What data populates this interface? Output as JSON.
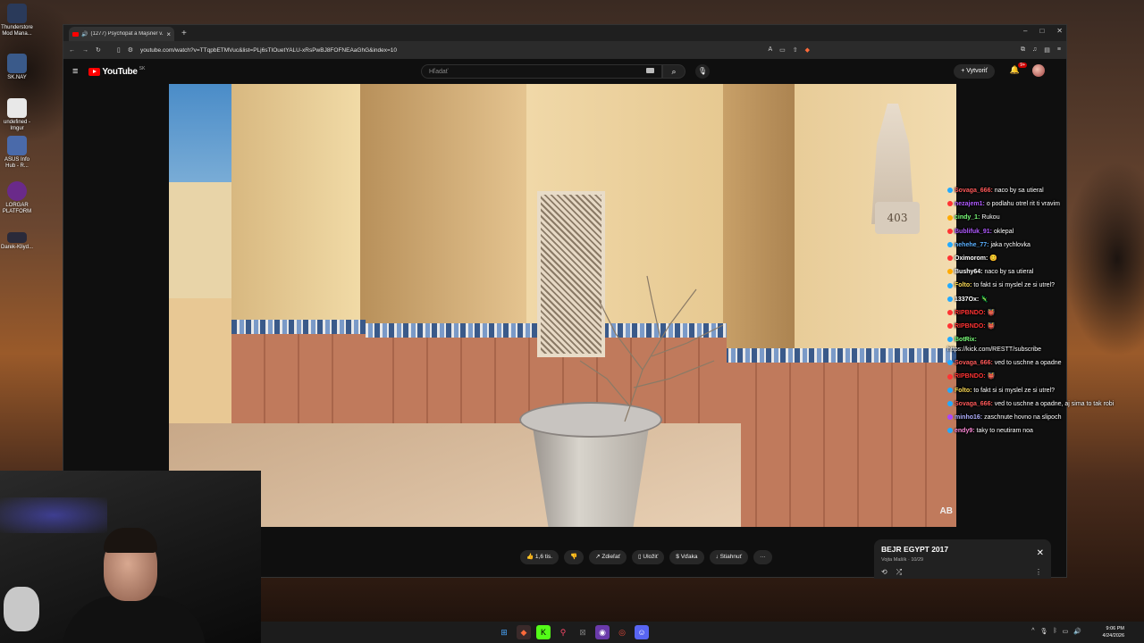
{
  "desktop": {
    "icons": [
      {
        "label": "Thunderstore Mod Mana...",
        "color": "#2a3a5a"
      },
      {
        "label": "SK.NAY",
        "color": "#3a5a8a"
      },
      {
        "label": "undefined - Imgur",
        "color": "#e8e8e8"
      },
      {
        "label": "ASUS Info Hub - R...",
        "color": "#4a6aaa"
      },
      {
        "label": "LORGAR PLATFORM",
        "color": "#6a2a8a"
      },
      {
        "label": "Darek-Kliyd...",
        "color": "#2a2a3a"
      }
    ]
  },
  "browser": {
    "tab_title": "(1277) Psychopat a Majsner v...",
    "url": "youtube.com/watch?v=TTqpbETMVuc&list=PLj6sTIOuetYALU-xRsPwBJ8FOFNEAaGhG&index=10",
    "window_controls": [
      "–",
      "□",
      "✕"
    ]
  },
  "youtube": {
    "logo_text": "YouTube",
    "country_code": "SK",
    "search_placeholder": "Hľadať",
    "create_label": "Vytvoriť",
    "notifications_badge": "9+"
  },
  "video": {
    "plaque_text": "403",
    "watermark": "AB"
  },
  "chat": [
    {
      "user": "Sovaga_666:",
      "message": "naco by sa utieral",
      "color": "#ff5a5a",
      "badge": "#22aaff"
    },
    {
      "user": "nezajem1:",
      "message": "o podlahu otrel rit ti vravim",
      "color": "#b05aff",
      "badge": "#ff3333"
    },
    {
      "user": "cindy_1:",
      "message": "Rukou",
      "color": "#7aff7a",
      "badge": "#ffaa00"
    },
    {
      "user": "Bublifuk_91:",
      "message": "oklepal",
      "color": "#b05aff",
      "badge": "#ff3333"
    },
    {
      "user": "nehehe_77:",
      "message": "jaka rychlovka",
      "color": "#5ab0ff",
      "badge": "#22aaff"
    },
    {
      "user": "Oximorom:",
      "message": "😊",
      "color": "#ffffff",
      "badge": "#ff3333"
    },
    {
      "user": "Bushy64:",
      "message": "naco by sa utieral",
      "color": "#ffffff",
      "badge": "#ffaa00"
    },
    {
      "user": "Folto:",
      "message": "to fakt si si myslel ze si utrel?",
      "color": "#ffdd55",
      "badge": "#22aaff"
    },
    {
      "user": "1337Ox:",
      "message": "🦎",
      "color": "#ffffff",
      "badge": "#22aaff"
    },
    {
      "user": "RIPBNDO:",
      "message": "👹",
      "color": "#ff3333",
      "badge": "#ff3333"
    },
    {
      "user": "RIPBNDO:",
      "message": "👹",
      "color": "#ff3333",
      "badge": "#ff3333"
    },
    {
      "user": "BotRix:",
      "message": "https://kick.com/RESTT/subscribe",
      "color": "#7aff7a",
      "badge": "#22aaff"
    },
    {
      "user": "Sovaga_666:",
      "message": "ved to uschne a opadne",
      "color": "#ff5a5a",
      "badge": "#22aaff"
    },
    {
      "user": "RIPBNDO:",
      "message": "👹",
      "color": "#ff3333",
      "badge": "#ff3333"
    },
    {
      "user": "Folto:",
      "message": "to fakt si si myslel ze si utrel?",
      "color": "#ffdd55",
      "badge": "#22aaff"
    },
    {
      "user": "Sovaga_666:",
      "message": "ved to uschne a opadne, aj sima to tak robi",
      "color": "#ff5a5a",
      "badge": "#22aaff"
    },
    {
      "user": "minho16:",
      "message": "zaschnute hovno na slipoch",
      "color": "#b0b0ff",
      "badge": "#aa44ff"
    },
    {
      "user": "endy9:",
      "message": "taky to neutiram noa",
      "color": "#ff8ad8",
      "badge": "#22aaff"
    }
  ],
  "actions": {
    "like": "1,6 tis.",
    "share": "Zdieľať",
    "save": "Uložiť",
    "thanks": "Vďaka",
    "download": "Stiahnuť",
    "more": "···"
  },
  "playlist": {
    "title": "BEJR EGYPT 2017",
    "subtitle": "Vojta Mašík · 10/29"
  },
  "taskbar": {
    "time": "9:06 PM",
    "date": "4/24/2026"
  }
}
